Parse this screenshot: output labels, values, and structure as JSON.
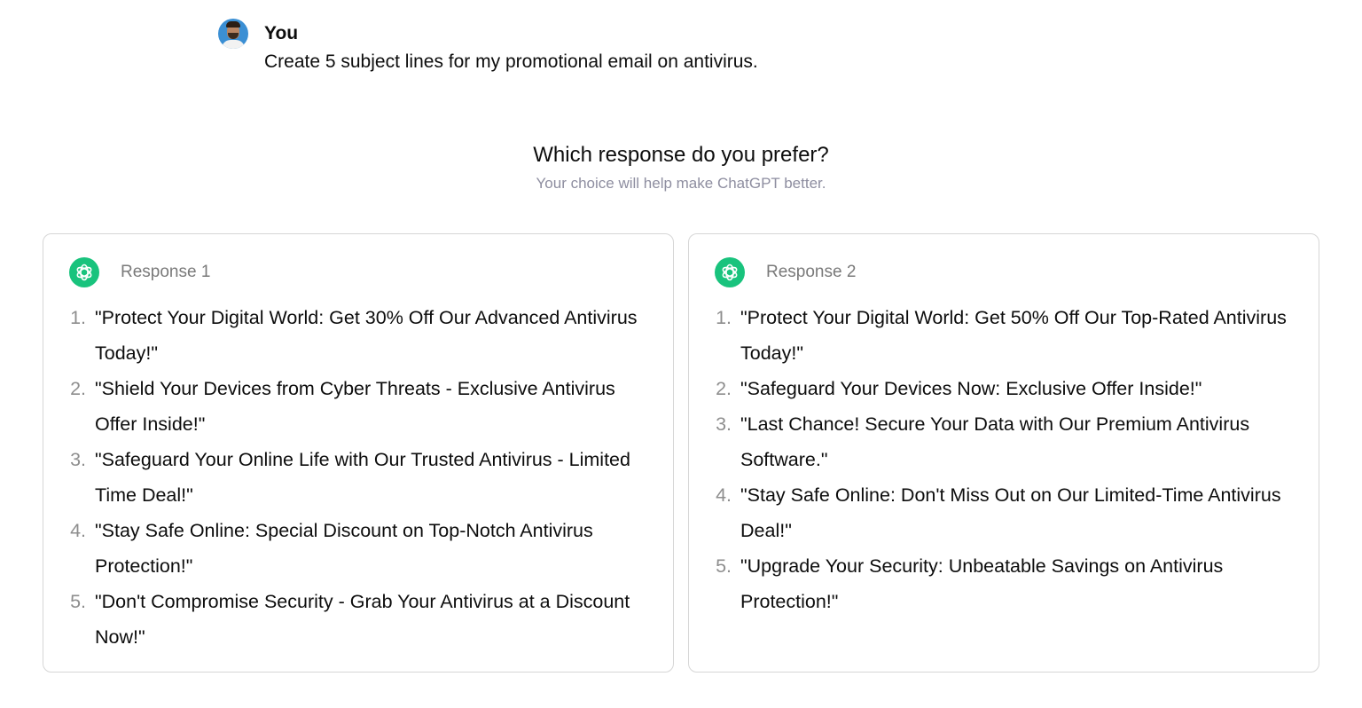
{
  "user": {
    "name": "You",
    "message": "Create 5 subject lines for my promotional email on antivirus."
  },
  "prompt": {
    "title": "Which response do you prefer?",
    "subtitle": "Your choice will help make ChatGPT better."
  },
  "responses": [
    {
      "title": "Response 1",
      "items": [
        {
          "num": "1.",
          "text": "\"Protect Your Digital World: Get 30% Off Our Advanced Antivirus Today!\""
        },
        {
          "num": "2.",
          "text": "\"Shield Your Devices from Cyber Threats - Exclusive Antivirus Offer Inside!\""
        },
        {
          "num": "3.",
          "text": "\"Safeguard Your Online Life with Our Trusted Antivirus - Limited Time Deal!\""
        },
        {
          "num": "4.",
          "text": "\"Stay Safe Online: Special Discount on Top-Notch Antivirus Protection!\""
        },
        {
          "num": "5.",
          "text": "\"Don't Compromise Security - Grab Your Antivirus at a Discount Now!\""
        }
      ]
    },
    {
      "title": "Response 2",
      "items": [
        {
          "num": "1.",
          "text": "\"Protect Your Digital World: Get 50% Off Our Top-Rated Antivirus Today!\""
        },
        {
          "num": "2.",
          "text": "\"Safeguard Your Devices Now: Exclusive Offer Inside!\""
        },
        {
          "num": "3.",
          "text": "\"Last Chance! Secure Your Data with Our Premium Antivirus Software.\""
        },
        {
          "num": "4.",
          "text": "\"Stay Safe Online: Don't Miss Out on Our Limited-Time Antivirus Deal!\""
        },
        {
          "num": "5.",
          "text": "\"Upgrade Your Security: Unbeatable Savings on Antivirus Protection!\""
        }
      ]
    }
  ],
  "colors": {
    "gpt_green": "#19c37d",
    "muted_text": "#8e8ea0",
    "card_border": "#d6d6d6"
  },
  "icons": {
    "avatar": "user-avatar",
    "assistant": "chatgpt-logo-icon"
  }
}
